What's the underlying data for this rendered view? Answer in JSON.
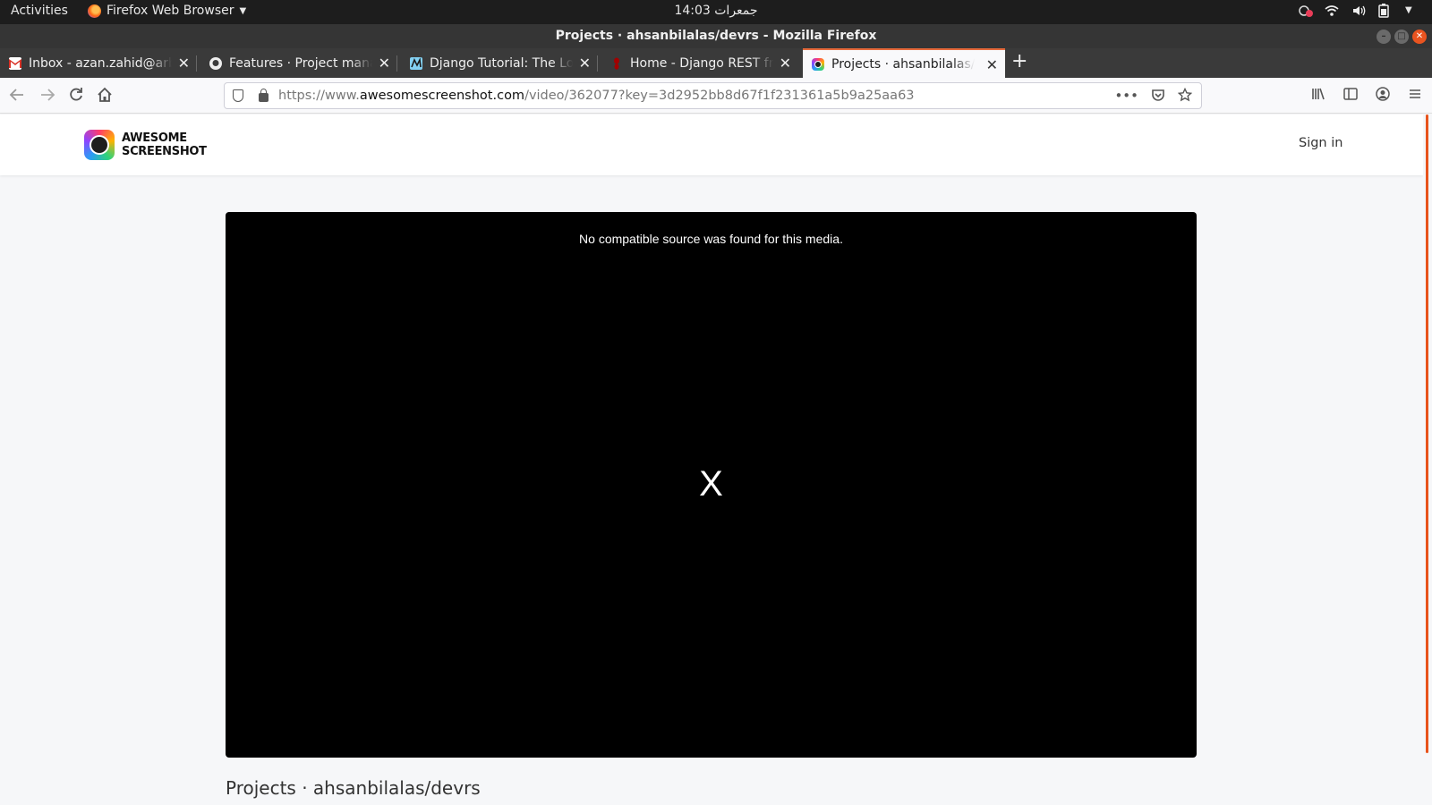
{
  "system": {
    "activities": "Activities",
    "app_name": "Firefox Web Browser",
    "clock": "جمعرات 14:03"
  },
  "window": {
    "title": "Projects · ahsanbilalas/devrs - Mozilla Firefox"
  },
  "tabs": [
    {
      "label": "Inbox - azan.zahid@arbisoft.com",
      "favicon": "gmail-icon"
    },
    {
      "label": "Features · Project management",
      "favicon": "github-icon"
    },
    {
      "label": "Django Tutorial: The Local Library",
      "favicon": "mdn-icon"
    },
    {
      "label": "Home - Django REST framework",
      "favicon": "drf-icon"
    },
    {
      "label": "Projects · ahsanbilalas/devrs",
      "favicon": "awesome-screenshot-icon",
      "active": true
    }
  ],
  "address_bar": {
    "prefix": "https://www.",
    "host": "awesomescreenshot.com",
    "path": "/video/362077?key=3d2952bb8d67f1f231361a5b9a25aa63"
  },
  "site": {
    "logo_line1": "AWESOME",
    "logo_line2": "SCREENSHOT",
    "sign_in": "Sign in"
  },
  "video": {
    "error_message": "No compatible source was found for this media.",
    "close_glyph": "X"
  },
  "page_title": "Projects · ahsanbilalas/devrs",
  "colors": {
    "accent": "#e66a3c",
    "video_bg": "#000000"
  }
}
